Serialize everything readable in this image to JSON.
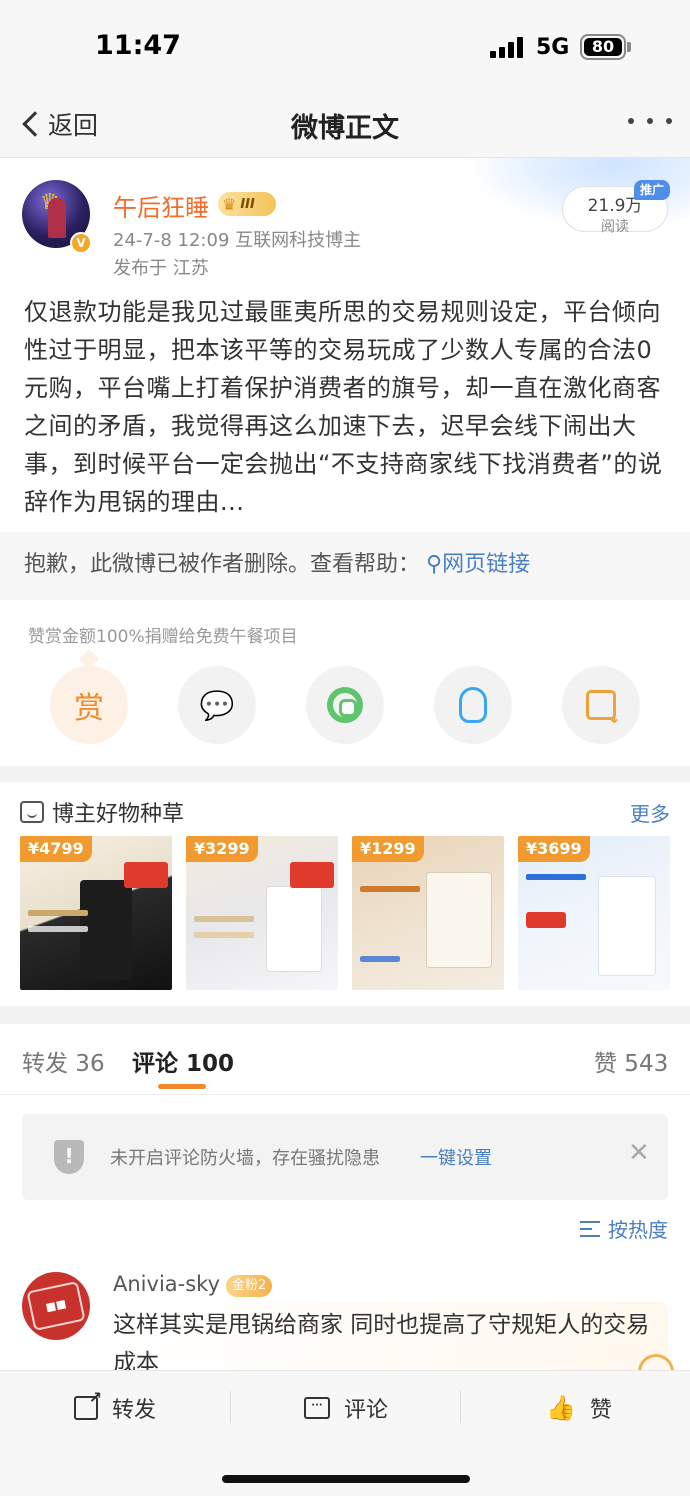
{
  "status_bar": {
    "time": "11:47",
    "network": "5G",
    "battery": "80"
  },
  "nav": {
    "back_label": "返回",
    "title": "微博正文"
  },
  "post": {
    "author": "午后狂睡",
    "vip_level": "III",
    "meta": "24-7-8 12:09  互联网科技博主",
    "location": "发布于 江苏",
    "reads": "21.9万",
    "reads_label": "阅读",
    "promo_tag": "推广",
    "text": "仅退款功能是我见过最匪夷所思的交易规则设定，平台倾向性过于明显，把本该平等的交易玩成了少数人专属的合法0元购，平台嘴上打着保护消费者的旗号，却一直在激化商客之间的矛盾，我觉得再这么加速下去，迟早会线下闹出大事，到时候平台一定会抛出“不支持商家线下找消费者”的说辞作为甩锅的理由...",
    "deleted_notice": "抱歉，此微博已被作者删除。查看帮助：",
    "help_link": "网页链接"
  },
  "reward": {
    "note": "赞赏金额100%捐赠给免费午餐项目",
    "reward_label": "赏"
  },
  "goods": {
    "title": "博主好物种草",
    "more": "更多",
    "items": [
      {
        "price": "¥4799"
      },
      {
        "price": "¥3299"
      },
      {
        "price": "¥1299"
      },
      {
        "price": "¥3699"
      }
    ]
  },
  "tabs": {
    "repost": "转发 36",
    "comment": "评论 100",
    "like": "赞 543"
  },
  "firewall": {
    "text": "未开启评论防火墙，存在骚扰隐患",
    "link": "一键设置"
  },
  "sort": {
    "label": "按热度"
  },
  "comment": {
    "user": "Anivia-sky",
    "fan_badge": "金粉2",
    "text": "这样其实是甩锅给商家 同时也提高了守规矩人的交易成本"
  },
  "actions": {
    "repost": "转发",
    "comment": "评论",
    "like": "赞"
  },
  "colors": {
    "accent_orange": "#f26d2a",
    "link_blue": "#4a7fc1",
    "tab_underline": "#f28a2c"
  }
}
